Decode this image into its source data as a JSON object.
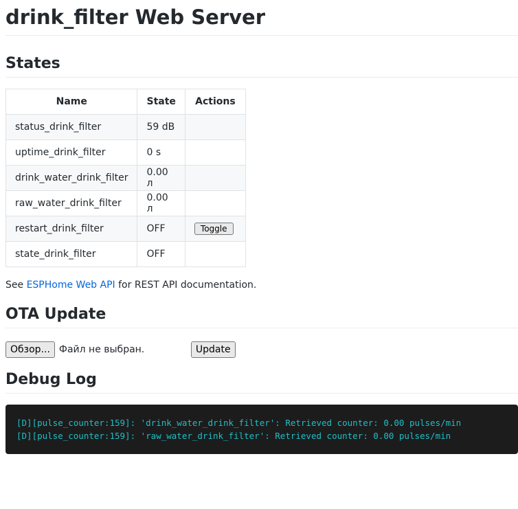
{
  "title": "drink_filter Web Server",
  "states": {
    "heading": "States",
    "headers": [
      "Name",
      "State",
      "Actions"
    ],
    "rows": [
      {
        "name": "status_drink_filter",
        "state": "59 dB"
      },
      {
        "name": "uptime_drink_filter",
        "state": "0 s"
      },
      {
        "name": "drink_water_drink_filter",
        "state": "0.00 л"
      },
      {
        "name": "raw_water_drink_filter",
        "state": "0.00 л"
      },
      {
        "name": "restart_drink_filter",
        "state": "OFF",
        "action": "Toggle"
      },
      {
        "name": "state_drink_filter",
        "state": "OFF"
      }
    ]
  },
  "api": {
    "prefix": "See ",
    "link": "ESPHome Web API",
    "suffix": " for REST API documentation."
  },
  "ota": {
    "heading": "OTA Update",
    "browse": "Обзор...",
    "file_status": "Файл не выбран.",
    "update": "Update"
  },
  "debug": {
    "heading": "Debug Log",
    "lines": [
      "[D][pulse_counter:159]: 'drink_water_drink_filter': Retrieved counter: 0.00 pulses/min",
      "[D][pulse_counter:159]: 'raw_water_drink_filter': Retrieved counter: 0.00 pulses/min"
    ]
  }
}
